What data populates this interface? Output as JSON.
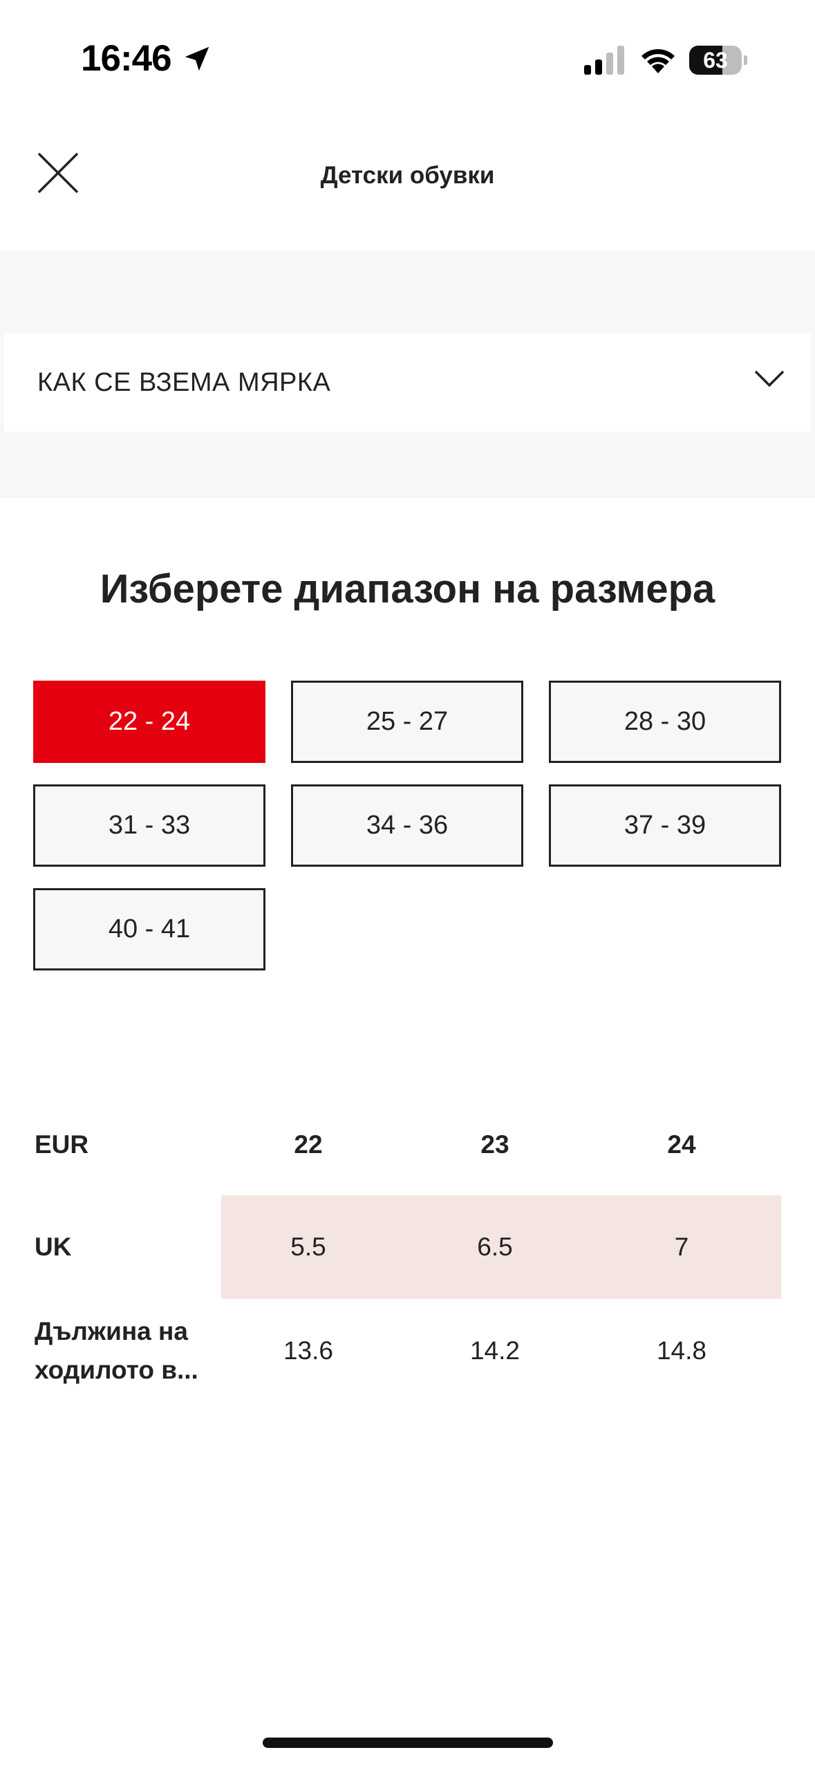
{
  "status_bar": {
    "time": "16:46",
    "battery": "63",
    "battery_level": 0.63
  },
  "header": {
    "title": "Детски обувки"
  },
  "accordion": {
    "label": "КАК СЕ ВЗЕМА МЯРКА"
  },
  "section": {
    "title": "Изберете диапазон на размера"
  },
  "ranges": [
    {
      "label": "22 - 24",
      "selected": true
    },
    {
      "label": "25 - 27",
      "selected": false
    },
    {
      "label": "28 - 30",
      "selected": false
    },
    {
      "label": "31 - 33",
      "selected": false
    },
    {
      "label": "34 - 36",
      "selected": false
    },
    {
      "label": "37 - 39",
      "selected": false
    },
    {
      "label": "40 - 41",
      "selected": false
    }
  ],
  "size_table": {
    "rows": [
      {
        "label": "EUR",
        "values": [
          "22",
          "23",
          "24"
        ]
      },
      {
        "label": "UK",
        "values": [
          "5.5",
          "6.5",
          "7"
        ]
      },
      {
        "label": "Дължина на ходилото в...",
        "values": [
          "13.6",
          "14.2",
          "14.8"
        ]
      }
    ]
  },
  "colors": {
    "accent": "#e50010",
    "highlight_row": "#f4e5e3",
    "grey_bg": "#f8f7f5"
  }
}
